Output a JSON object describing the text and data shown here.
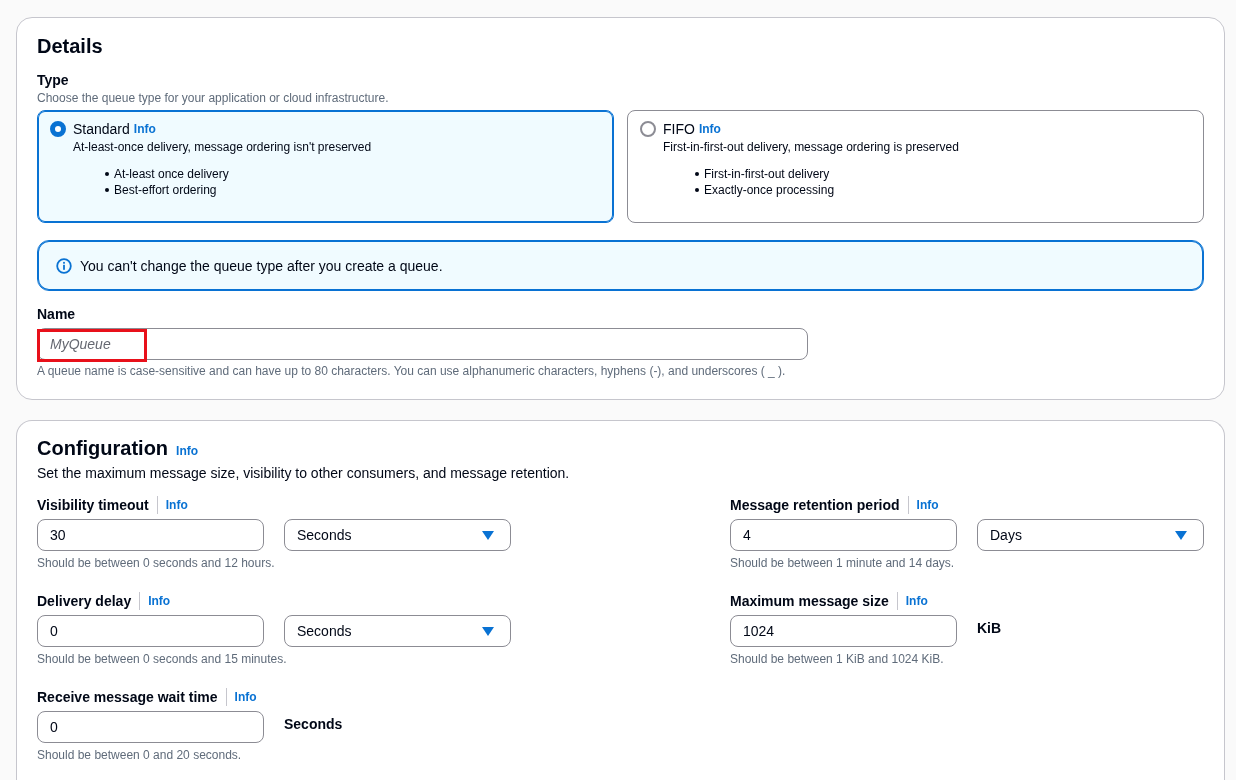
{
  "details": {
    "title": "Details",
    "type_field": {
      "label": "Type",
      "description": "Choose the queue type for your application or cloud infrastructure.",
      "options": [
        {
          "label": "Standard",
          "info": "Info",
          "selected": true,
          "description": "At-least-once delivery, message ordering isn't preserved",
          "features": [
            "At-least once delivery",
            "Best-effort ordering"
          ]
        },
        {
          "label": "FIFO",
          "info": "Info",
          "selected": false,
          "description": "First-in-first-out delivery, message ordering is preserved",
          "features": [
            "First-in-first-out delivery",
            "Exactly-once processing"
          ]
        }
      ]
    },
    "alert": {
      "text": "You can't change the queue type after you create a queue."
    },
    "name_field": {
      "label": "Name",
      "placeholder": "MyQueue",
      "highlighted": true,
      "hint": "A queue name is case-sensitive and can have up to 80 characters. You can use alphanumeric characters, hyphens (-), and underscores ( _ )."
    }
  },
  "configuration": {
    "title": "Configuration",
    "info": "Info",
    "description": "Set the maximum message size, visibility to other consumers, and message retention.",
    "left_column": [
      {
        "label": "Visibility timeout",
        "info": "Info",
        "value": "30",
        "kind": "select",
        "unit": "Seconds",
        "hint": "Should be between 0 seconds and 12 hours."
      },
      {
        "label": "Delivery delay",
        "info": "Info",
        "value": "0",
        "kind": "select",
        "unit": "Seconds",
        "hint": "Should be between 0 seconds and 15 minutes."
      },
      {
        "label": "Receive message wait time",
        "info": "Info",
        "value": "0",
        "kind": "static",
        "unit": "Seconds",
        "hint": "Should be between 0 and 20 seconds."
      }
    ],
    "right_column": [
      {
        "label": "Message retention period",
        "info": "Info",
        "value": "4",
        "kind": "select",
        "unit": "Days",
        "hint": "Should be between 1 minute and 14 days."
      },
      {
        "label": "Maximum message size",
        "info": "Info",
        "value": "1024",
        "kind": "static",
        "unit": "KiB",
        "hint": "Should be between 1 KiB and 1024 KiB."
      }
    ]
  }
}
